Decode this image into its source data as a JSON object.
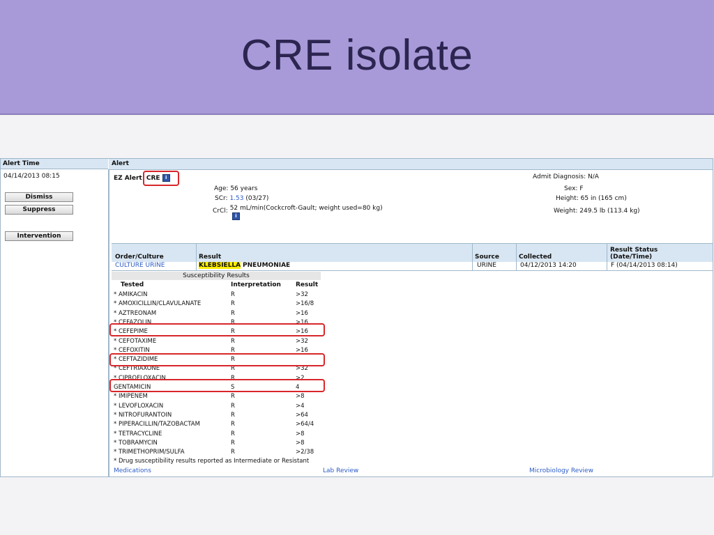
{
  "slide": {
    "title": "CRE isolate"
  },
  "headers": {
    "alert_time": "Alert Time",
    "alert": "Alert"
  },
  "left": {
    "time": "04/14/2013 08:15",
    "dismiss": "Dismiss",
    "suppress": "Suppress",
    "intervention": "Intervention"
  },
  "alert": {
    "ez_label": "EZ Alert",
    "cre": "CRE",
    "info_glyph": "i",
    "age_label": "Age:",
    "age": "56 years",
    "scr_label": "SCr:",
    "scr_value": "1.53",
    "scr_date": "(03/27)",
    "crcl_label": "CrCl:",
    "crcl": "52 mL/min(Cockcroft-Gault; weight used=80 kg)",
    "admit_label": "Admit Diagnosis:",
    "admit": "N/A",
    "sex_label": "Sex:",
    "sex": "F",
    "height_label": "Height:",
    "height": "65 in (165 cm)",
    "weight_label": "Weight:",
    "weight": "249.5 lb (113.4 kg)"
  },
  "order_table": {
    "headers": {
      "order": "Order/Culture",
      "result": "Result",
      "source": "Source",
      "collected": "Collected",
      "status_line1": "Result Status",
      "status_line2": "(Date/Time)"
    },
    "row": {
      "order": "CULTURE URINE",
      "result_hl": "KLEBSIELLA",
      "result_rest": "PNEUMONIAE",
      "source": "URINE",
      "collected": "04/12/2013 14:20",
      "status": "F (04/14/2013 08:14)"
    }
  },
  "susceptibility": {
    "title": "Susceptibility Results",
    "headers": {
      "tested": "Tested",
      "interp": "Interpretation",
      "result": "Result"
    },
    "rows": [
      {
        "drug": "* AMIKACIN",
        "interp": "R",
        "result": ">32"
      },
      {
        "drug": "* AMOXICILLIN/CLAVULANATE",
        "interp": "R",
        "result": ">16/8"
      },
      {
        "drug": "* AZTREONAM",
        "interp": "R",
        "result": ">16"
      },
      {
        "drug": "* CEFAZOLIN",
        "interp": "R",
        "result": ">16"
      },
      {
        "drug": "* CEFEPIME",
        "interp": "R",
        "result": ">16"
      },
      {
        "drug": "* CEFOTAXIME",
        "interp": "R",
        "result": ">32"
      },
      {
        "drug": "* CEFOXITIN",
        "interp": "R",
        "result": ">16"
      },
      {
        "drug": "* CEFTAZIDIME",
        "interp": "R",
        "result": ""
      },
      {
        "drug": "* CEFTRIAXONE",
        "interp": "R",
        "result": ">32"
      },
      {
        "drug": "* CIPROFLOXACIN",
        "interp": "R",
        "result": ">2"
      },
      {
        "drug": "GENTAMICIN",
        "interp": "S",
        "result": "4"
      },
      {
        "drug": "* IMIPENEM",
        "interp": "R",
        "result": ">8"
      },
      {
        "drug": "* LEVOFLOXACIN",
        "interp": "R",
        "result": ">4"
      },
      {
        "drug": "* NITROFURANTOIN",
        "interp": "R",
        "result": ">64"
      },
      {
        "drug": "* PIPERACILLIN/TAZOBACTAM",
        "interp": "R",
        "result": ">64/4"
      },
      {
        "drug": "* TETRACYCLINE",
        "interp": "R",
        "result": ">8"
      },
      {
        "drug": "* TOBRAMYCIN",
        "interp": "R",
        "result": ">8"
      },
      {
        "drug": "* TRIMETHOPRIM/SULFA",
        "interp": "R",
        "result": ">2/38"
      }
    ],
    "footnote": "* Drug susceptibility results reported as Intermediate or Resistant"
  },
  "links": {
    "medications": "Medications",
    "lab_review": "Lab Review",
    "micro_review": "Microbiology Review"
  },
  "colors": {
    "banner": "#a89ad8",
    "header_bg": "#d8e6f3",
    "highlight_box": "#d8262a",
    "link": "#2c5cc5",
    "organism_highlight": "#ffee00"
  }
}
